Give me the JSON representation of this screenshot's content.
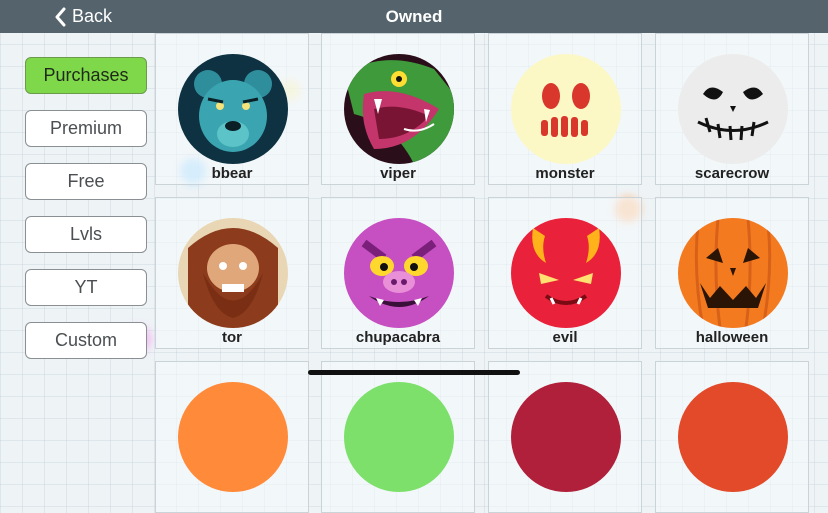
{
  "header": {
    "back_label": "Back",
    "title": "Owned"
  },
  "sidebar": {
    "items": [
      {
        "label": "Purchases",
        "active": true
      },
      {
        "label": "Premium",
        "active": false
      },
      {
        "label": "Free",
        "active": false
      },
      {
        "label": "Lvls",
        "active": false
      },
      {
        "label": "YT",
        "active": false
      },
      {
        "label": "Custom",
        "active": false
      }
    ]
  },
  "skins": [
    {
      "name": "bbear",
      "icon": "bear-icon"
    },
    {
      "name": "viper",
      "icon": "snake-icon"
    },
    {
      "name": "monster",
      "icon": "monster-face-icon"
    },
    {
      "name": "scarecrow",
      "icon": "scarecrow-face-icon"
    },
    {
      "name": "tor",
      "icon": "warrior-face-icon"
    },
    {
      "name": "chupacabra",
      "icon": "chupacabra-face-icon"
    },
    {
      "name": "evil",
      "icon": "devil-face-icon"
    },
    {
      "name": "halloween",
      "icon": "pumpkin-face-icon"
    }
  ],
  "colors": {
    "topbar": "#55646c",
    "active_tab": "#7fd84a"
  }
}
